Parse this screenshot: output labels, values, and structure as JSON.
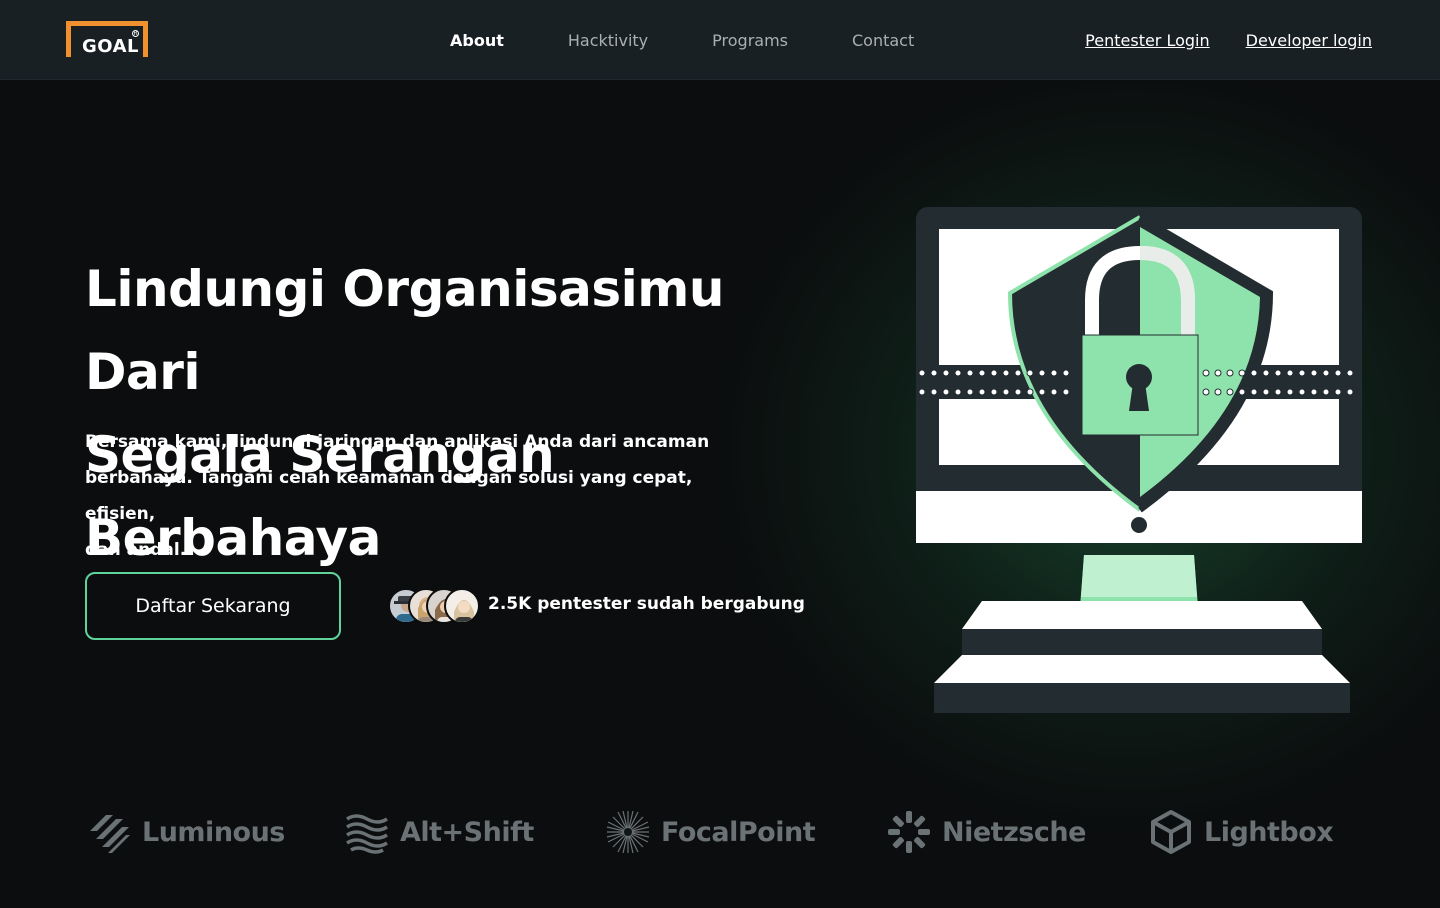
{
  "header": {
    "logo_text": "GOAL",
    "nav": [
      {
        "label": "About",
        "active": true
      },
      {
        "label": "Hacktivity",
        "active": false
      },
      {
        "label": "Programs",
        "active": false
      },
      {
        "label": "Contact",
        "active": false
      }
    ],
    "pentester_login": "Pentester Login",
    "developer_login": "Developer login"
  },
  "hero": {
    "title_line1": "Lindungi Organisasimu Dari",
    "title_line2": "Segala Serangan Berbahaya",
    "description_line1": "Bersama kami, lindungi jaringan dan aplikasi Anda dari ancaman",
    "description_line2": "berbahaya. Tangani celah keamanan dengan solusi yang cepat, efisien,",
    "description_line3": "dan andal.",
    "cta_label": "Daftar Sekarang",
    "social_proof": "2.5K pentester sudah bergabung"
  },
  "brands": [
    {
      "name": "Luminous",
      "icon": "luminous-logo-icon"
    },
    {
      "name": "Alt+Shift",
      "icon": "altshift-logo-icon"
    },
    {
      "name": "FocalPoint",
      "icon": "focalpoint-logo-icon"
    },
    {
      "name": "Nietzsche",
      "icon": "nietzsche-logo-icon"
    },
    {
      "name": "Lightbox",
      "icon": "lightbox-logo-icon"
    }
  ],
  "colors": {
    "accent": "#f0902e",
    "green": "#8ee2ab",
    "dark": "#232c30",
    "cta_border": "#5fd39a"
  }
}
